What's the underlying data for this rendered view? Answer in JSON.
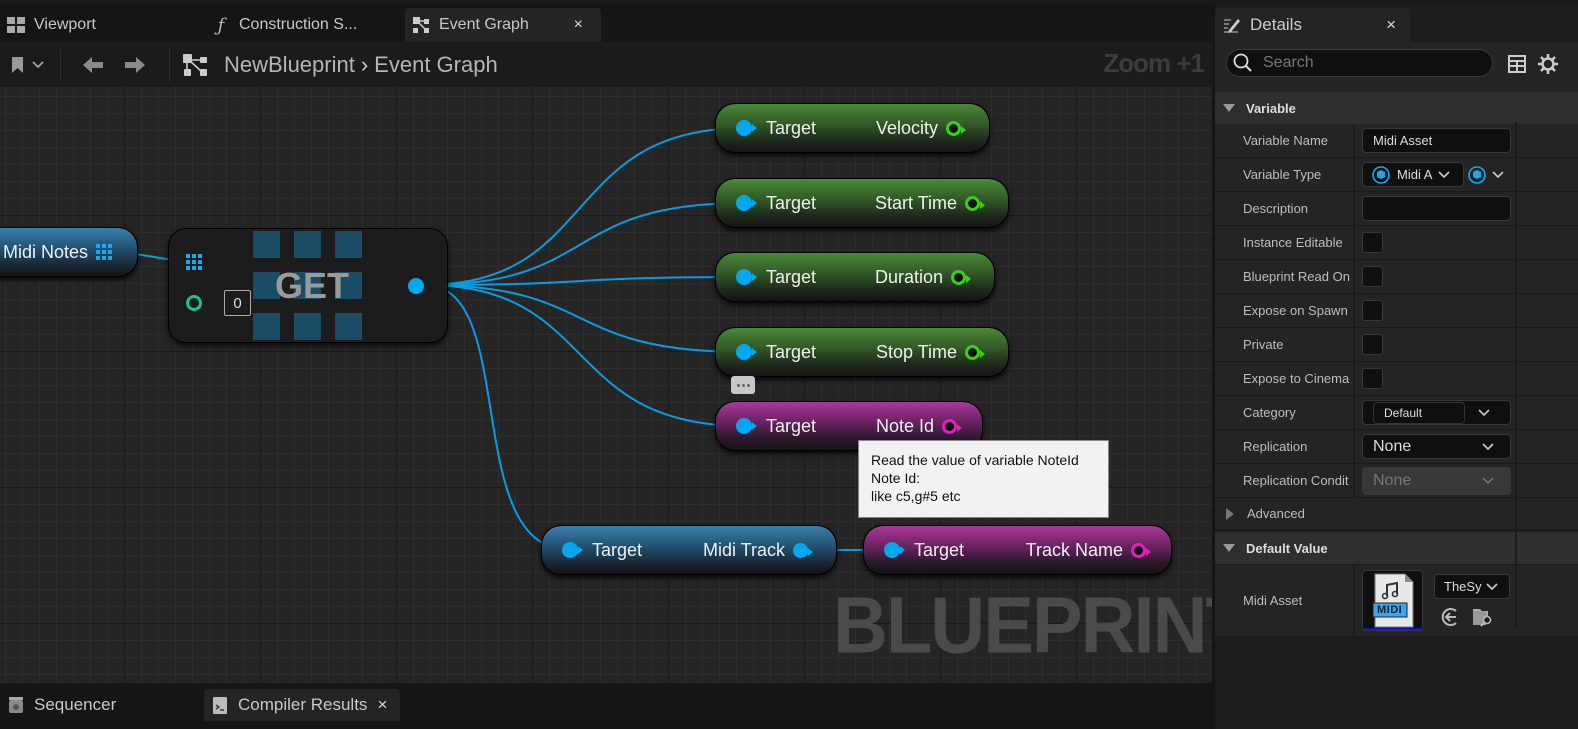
{
  "tabs": [
    {
      "label": "Viewport",
      "icon": "viewport-icon",
      "active": false
    },
    {
      "label": "Construction S...",
      "icon": "function-icon",
      "active": false
    },
    {
      "label": "Event Graph",
      "icon": "graph-icon",
      "active": true,
      "close": "×"
    }
  ],
  "toolbar": {
    "breadcrumb_root": "NewBlueprint",
    "breadcrumb_sep": "›",
    "breadcrumb_current": "Event Graph",
    "zoom": "Zoom +1"
  },
  "graph": {
    "var_node": {
      "label": "Midi Notes"
    },
    "get_node": {
      "title": "GET",
      "index": "0"
    },
    "nodes": [
      {
        "input": "Target",
        "output": "Velocity",
        "color": "green"
      },
      {
        "input": "Target",
        "output": "Start Time",
        "color": "green"
      },
      {
        "input": "Target",
        "output": "Duration",
        "color": "green"
      },
      {
        "input": "Target",
        "output": "Stop Time",
        "color": "green"
      },
      {
        "input": "Target",
        "output": "Note Id",
        "color": "pink"
      },
      {
        "input": "Target",
        "output": "Midi Track",
        "color": "blue"
      },
      {
        "input": "Target",
        "output": "Track Name",
        "color": "pink"
      }
    ],
    "tooltip": {
      "line1": "Read the value of variable NoteId",
      "line2": "Note Id:",
      "line3": "like c5,g#5 etc"
    },
    "watermark": "BLUEPRINT"
  },
  "bottom_tabs": [
    {
      "label": "Sequencer",
      "icon": "sequencer-icon"
    },
    {
      "label": "Compiler Results",
      "icon": "compiler-icon",
      "close": "×"
    }
  ],
  "details": {
    "title": "Details",
    "close": "×",
    "search_placeholder": "Search",
    "sections": {
      "variable": "Variable",
      "advanced": "Advanced",
      "default_value": "Default Value"
    },
    "rows": [
      {
        "label": "Variable Name",
        "value": "Midi Asset"
      },
      {
        "label": "Variable Type",
        "value": "Midi A"
      },
      {
        "label": "Description",
        "value": ""
      },
      {
        "label": "Instance Editable",
        "checked": false
      },
      {
        "label": "Blueprint Read On",
        "checked": false
      },
      {
        "label": "Expose on Spawn",
        "checked": false
      },
      {
        "label": "Private",
        "checked": false
      },
      {
        "label": "Expose to Cinema",
        "checked": false
      },
      {
        "label": "Category",
        "value": "Default"
      },
      {
        "label": "Replication",
        "value": "None"
      },
      {
        "label": "Replication Condit",
        "value": "None"
      }
    ],
    "default_value": {
      "label": "Midi Asset",
      "asset_badge": "MIDI",
      "asset_name": "TheSy"
    },
    "colors": {
      "accent_blue": "#00a8f0",
      "float_green": "#3ad01a",
      "string_pink": "#e020c0",
      "int_teal": "#1fc08f"
    }
  }
}
